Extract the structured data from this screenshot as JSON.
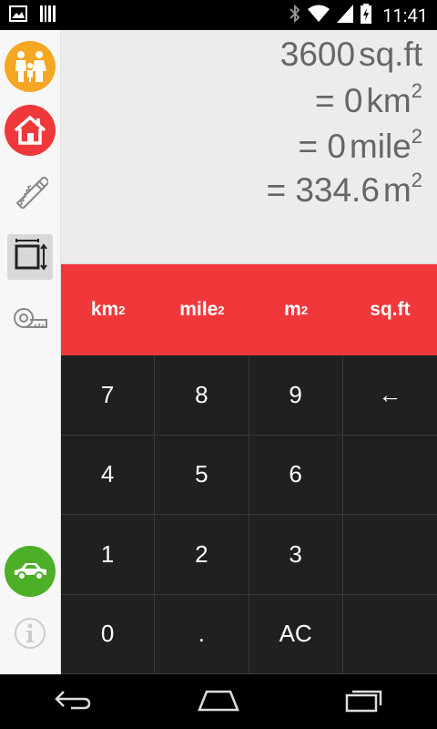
{
  "status_bar": {
    "time": "11:41",
    "icons": [
      "image-icon",
      "barcode-icon",
      "bluetooth-icon",
      "wifi-icon",
      "signal-icon",
      "battery-icon"
    ]
  },
  "sidebar": {
    "items": [
      {
        "name": "family",
        "icon": "family-icon",
        "color": "#f5a623"
      },
      {
        "name": "house",
        "icon": "house-icon",
        "color": "#f0383b"
      },
      {
        "name": "saw",
        "icon": "saw-icon"
      },
      {
        "name": "area",
        "icon": "area-icon",
        "selected": true
      },
      {
        "name": "tape",
        "icon": "tape-measure-icon"
      },
      {
        "name": "car",
        "icon": "car-icon",
        "color": "#4caf27"
      },
      {
        "name": "info",
        "icon": "info-icon"
      }
    ]
  },
  "display": {
    "line1": {
      "value": "3600",
      "unit": "sq.ft",
      "sup": ""
    },
    "line2": {
      "prefix": "= ",
      "value": "0",
      "unit": "km",
      "sup": "2"
    },
    "line3": {
      "prefix": "= ",
      "value": "0",
      "unit": "mile",
      "sup": "2"
    },
    "line4": {
      "prefix": "= ",
      "value": "334.6",
      "unit": "m",
      "sup": "2"
    }
  },
  "units": [
    {
      "label": "km",
      "sup": "2"
    },
    {
      "label": "mile",
      "sup": "2"
    },
    {
      "label": "m",
      "sup": "2"
    },
    {
      "label": "sq.ft",
      "sup": ""
    }
  ],
  "keypad": {
    "keys": [
      "7",
      "8",
      "9",
      "←",
      "4",
      "5",
      "6",
      "",
      "1",
      "2",
      "3",
      "",
      "0",
      ".",
      "AC",
      ""
    ]
  },
  "colors": {
    "accent_red": "#f0383b",
    "keypad_bg": "#202020",
    "display_bg": "#ececec"
  }
}
